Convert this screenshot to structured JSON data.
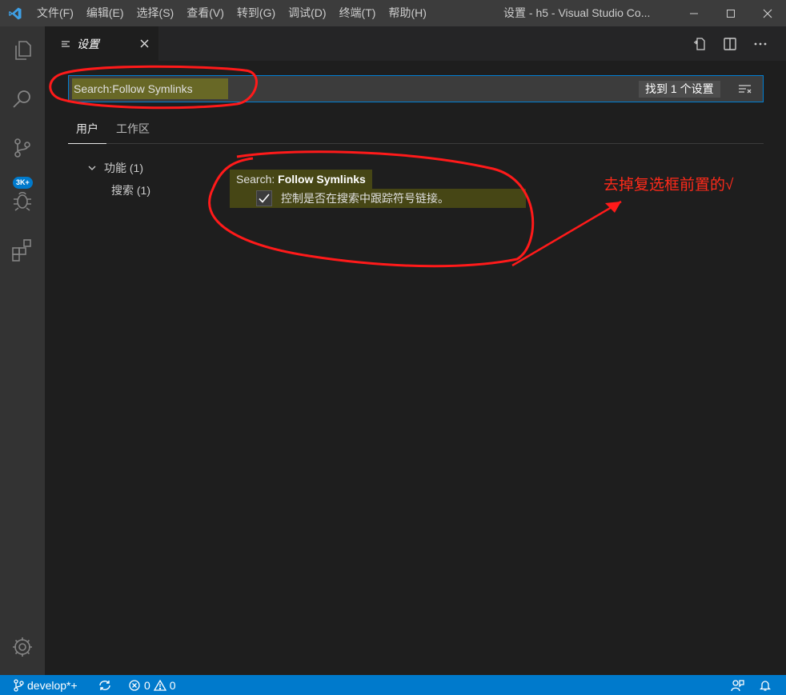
{
  "app": {
    "logo_icon": "vscode-logo-icon",
    "menu": [
      "文件(F)",
      "编辑(E)",
      "选择(S)",
      "查看(V)",
      "转到(G)",
      "调试(D)",
      "终端(T)",
      "帮助(H)"
    ],
    "window_title": "设置 - h5 - Visual Studio Co..."
  },
  "activity_bar": {
    "items": [
      "explorer-icon",
      "search-icon",
      "source-control-icon",
      "debug-icon",
      "extensions-icon"
    ],
    "scm_badge": "3K+",
    "bottom": "gear-icon"
  },
  "tab": {
    "label": "设置",
    "icon": "settings-list-icon"
  },
  "editor_actions": [
    "open-settings-json-icon",
    "split-editor-icon",
    "more-actions-icon"
  ],
  "search": {
    "value": "Search:Follow Symlinks",
    "result_count": "找到 1 个设置",
    "clear_icon": "clear-filter-icon"
  },
  "scopes": {
    "user": "用户",
    "workspace": "工作区"
  },
  "toc": {
    "group_label": "功能",
    "group_count": "(1)",
    "child_label": "搜索",
    "child_count": "(1)"
  },
  "setting": {
    "category": "Search: ",
    "key": "Follow Symlinks",
    "description": "控制是否在搜索中跟踪符号链接。",
    "checked": true
  },
  "annotation": {
    "text": "去掉复选框前置的√",
    "color": "#ff2a1a"
  },
  "status_bar": {
    "branch": "develop*+",
    "errors": "0",
    "warnings": "0",
    "background": "#007acc"
  }
}
